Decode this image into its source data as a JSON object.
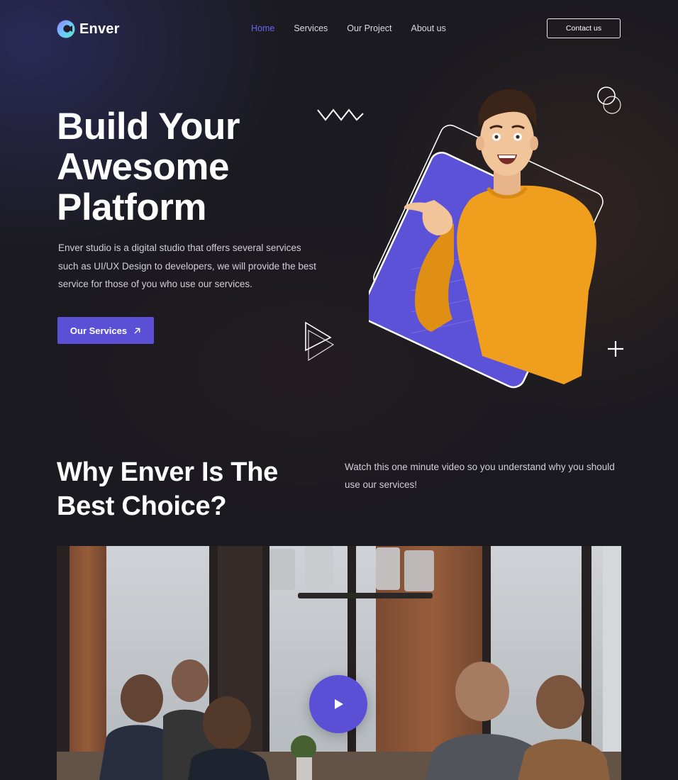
{
  "brand": {
    "name": "Enver",
    "logo_icon": "enver-logo-icon"
  },
  "nav": {
    "items": [
      {
        "label": "Home",
        "active": true
      },
      {
        "label": "Services",
        "active": false
      },
      {
        "label": "Our Project",
        "active": false
      },
      {
        "label": "About us",
        "active": false
      }
    ],
    "contact_label": "Contact us"
  },
  "hero": {
    "title_lines": [
      "Build Your",
      "Awesome",
      "Platform"
    ],
    "description": "Enver studio is a digital studio that offers several services such as UI/UX Design to developers, we will provide the best service for those of you who use our services.",
    "cta_label": "Our Services",
    "cta_icon": "arrow-up-right-icon"
  },
  "why": {
    "title_lines": [
      "Why Enver Is The",
      "Best Choice?"
    ],
    "description": "Watch this one minute video so you understand why you should use our services!",
    "video_icon": "play-icon"
  },
  "colors": {
    "accent": "#5b4fd6",
    "nav_active": "#6b63ee",
    "background": "#1b1a20",
    "sweater": "#f0a020"
  }
}
